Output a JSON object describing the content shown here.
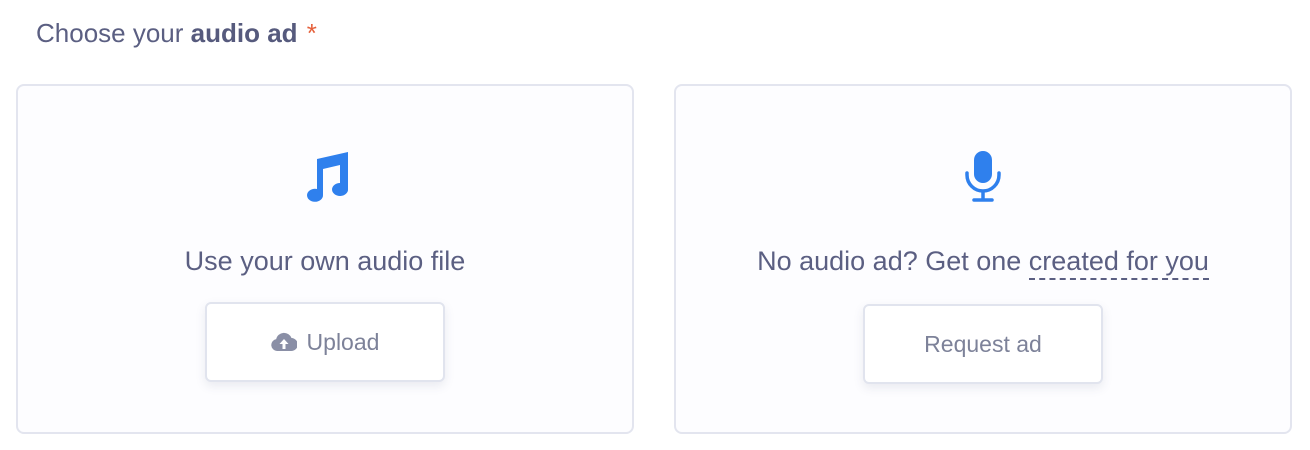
{
  "heading": {
    "prefix": "Choose your",
    "bold": "audio ad",
    "required_marker": "*"
  },
  "cards": {
    "own_file": {
      "icon": "music-note-icon",
      "text": "Use your own audio file",
      "button": {
        "icon": "cloud-upload-icon",
        "label": "Upload"
      }
    },
    "request": {
      "icon": "microphone-icon",
      "text_prefix": "No audio ad? Get one ",
      "text_link": "created for you",
      "button": {
        "label": "Request ad"
      }
    }
  },
  "colors": {
    "accent": "#2f80ed",
    "text": "#5b5f82",
    "required": "#e5603b",
    "border": "#e3e5ef",
    "button_text": "#7d8299"
  }
}
